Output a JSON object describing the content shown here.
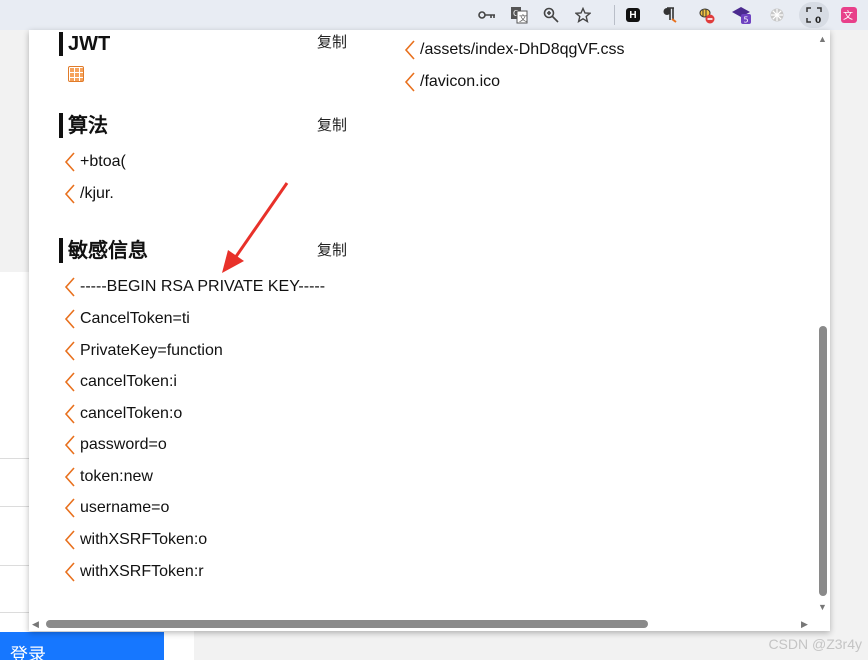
{
  "toolbar": {
    "icons": [
      "key-icon",
      "translate-icon",
      "zoom-icon",
      "star-icon",
      "extension-h-icon",
      "pilcrow-icon",
      "bee-icon",
      "cap-icon",
      "wheel-icon",
      "screenshot-icon",
      "extension-pink-icon"
    ],
    "ext_h_label": "H",
    "ext_cap_badge": "5",
    "ext_screenshot_badge": "0",
    "accent": "#e8ecf3"
  },
  "background_page": {
    "login_label": "登录",
    "login_color": "#1677ff"
  },
  "popup": {
    "copy_label": "复制",
    "accent_chevron": "#e8701d",
    "sections": [
      {
        "title": "JWT"
      },
      {
        "title": "算法",
        "items": [
          "+btoa(",
          "/kjur."
        ]
      },
      {
        "title": "敏感信息",
        "items": [
          "-----BEGIN RSA PRIVATE KEY-----",
          "CancelToken=ti",
          "PrivateKey=function",
          "cancelToken:i",
          "cancelToken:o",
          "password=o",
          "token:new",
          "username=o",
          "withXSRFToken:o",
          "withXSRFToken:r"
        ]
      }
    ],
    "right_items": [
      "/assets/index-DhD8qgVF.css",
      "/favicon.ico"
    ]
  },
  "watermark": "CSDN @Z3r4y"
}
